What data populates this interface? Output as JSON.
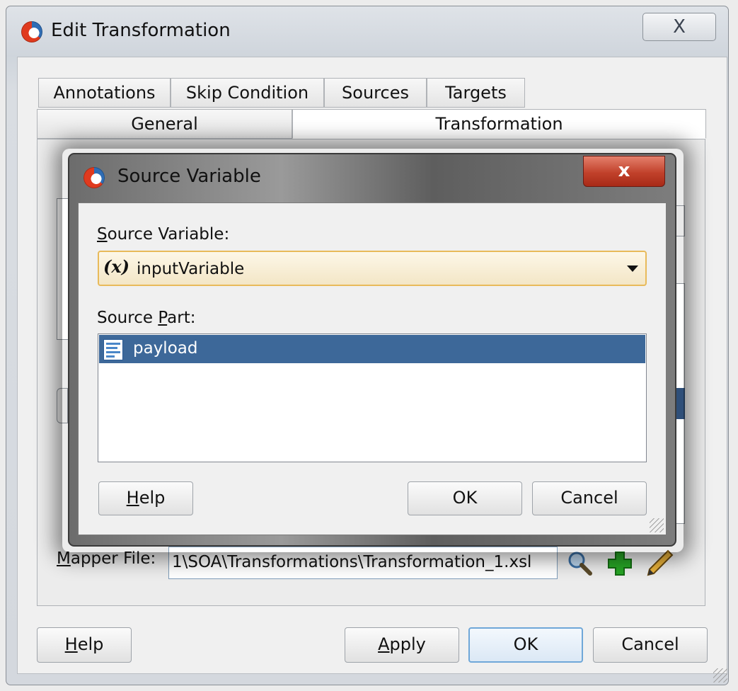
{
  "outer_window": {
    "title": "Edit Transformation",
    "close_glyph": "X",
    "tabs_row1": [
      "Annotations",
      "Skip Condition",
      "Sources",
      "Targets"
    ],
    "tabs_row2": [
      "General",
      "Transformation"
    ],
    "selected_tab": "Transformation",
    "mapper_file": {
      "label_mnemonic": "M",
      "label_rest": "apper File:",
      "value": "1\\SOA\\Transformations\\Transformation_1.xsl"
    },
    "buttons": {
      "help_mnemonic": "H",
      "help_rest": "elp",
      "apply_mnemonic": "A",
      "apply_rest": "pply",
      "ok": "OK",
      "cancel": "Cancel"
    },
    "toolbar_icons": [
      "search-icon",
      "add-icon",
      "edit-pencil-icon"
    ]
  },
  "modal": {
    "title": "Source Variable",
    "close_glyph": "x",
    "source_variable": {
      "label_mnemonic": "S",
      "label_rest": "ource Variable:",
      "icon_glyph": "(x)",
      "value": "inputVariable"
    },
    "source_part": {
      "label_before": "Source ",
      "label_mnemonic": "P",
      "label_after": "art:",
      "items": [
        {
          "label": "payload",
          "icon": "message-part-icon",
          "selected": true
        }
      ]
    },
    "buttons": {
      "help_mnemonic": "H",
      "help_rest": "elp",
      "ok": "OK",
      "cancel": "Cancel"
    }
  },
  "colors": {
    "selection": "#3d6899",
    "modal_close": "#c1412b",
    "combo_border": "#e8ba5a",
    "default_button_border": "#6fa7d8"
  }
}
